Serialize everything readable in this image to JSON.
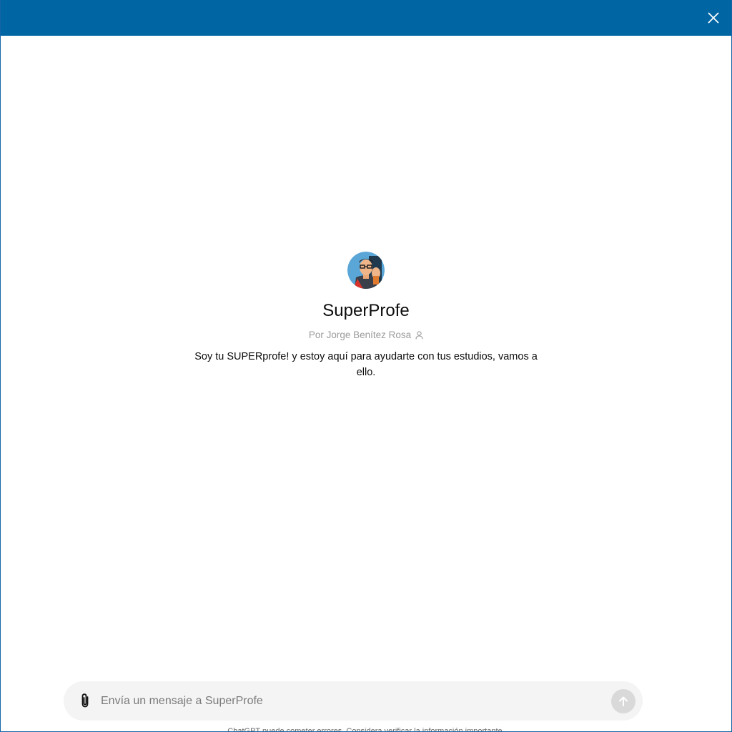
{
  "titlebar": {
    "color": "#0065a3",
    "close_icon": "close-icon"
  },
  "gpt": {
    "name": "SuperProfe",
    "author": "Por Jorge Benítez Rosa",
    "author_icon": "person-icon",
    "description": "Soy tu SUPERprofe! y estoy aquí para ayudarte con tus estudios, vamos a ello.",
    "avatar_icon": "superhero-avatar-icon"
  },
  "composer": {
    "placeholder": "Envía un mensaje a SuperProfe",
    "value": "",
    "attach_icon": "paperclip-icon",
    "send_icon": "arrow-up-icon"
  },
  "footer": {
    "note": "ChatGPT puede cometer errores. Considera verificar la información importante."
  }
}
